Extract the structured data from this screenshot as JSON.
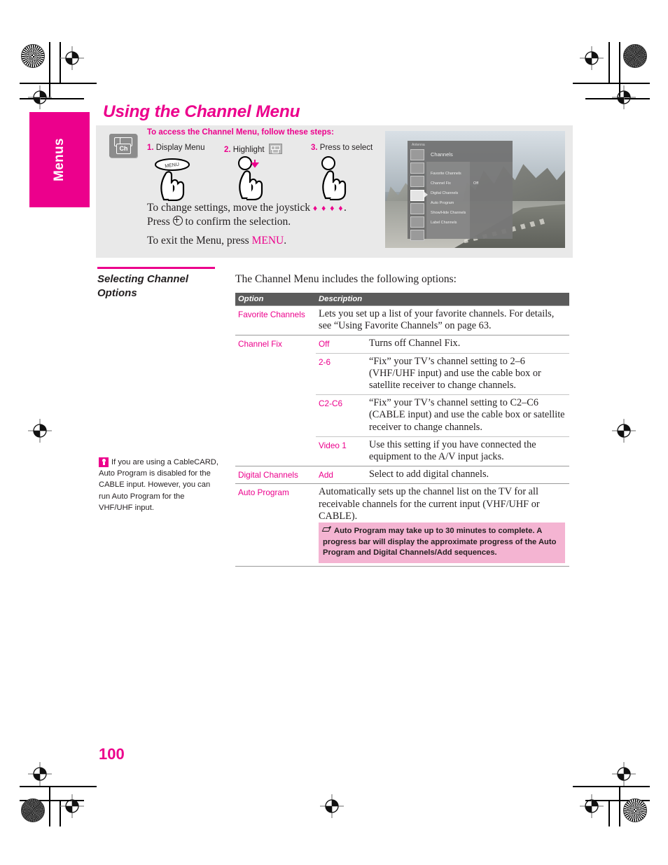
{
  "page": {
    "number": "100",
    "side_tab_label": "Menus",
    "title": "Using the Channel Menu"
  },
  "info_panel": {
    "icon_label": "Ch",
    "steps_heading": "To access the Channel Menu, follow these steps:",
    "steps": [
      {
        "num": "1.",
        "label": "Display Menu"
      },
      {
        "num": "2.",
        "label": "Highlight"
      },
      {
        "num": "3.",
        "label": "Press to select"
      }
    ],
    "remote_button_label": "MENU",
    "instruction_line1_a": "To change settings, move the joystick ",
    "instruction_line1_arrows": "♦ ♦ ♦ ♦",
    "instruction_line1_b": ".",
    "instruction_line2_a": "Press ",
    "instruction_line2_b": " to confirm the selection.",
    "instruction_exit_a": "To exit the Menu, press ",
    "instruction_exit_menu": "MENU",
    "instruction_exit_b": "."
  },
  "tv_osd": {
    "antenna_label": "Antenna",
    "title": "Channels",
    "items": [
      {
        "label": "Favorite Channels",
        "value": ""
      },
      {
        "label": "Channel Fix",
        "value": "Off"
      },
      {
        "label": "Digital Channels",
        "value": ""
      },
      {
        "label": "Auto Program",
        "value": ""
      },
      {
        "label": "Show/Hide Channels",
        "value": ""
      },
      {
        "label": "Label Channels",
        "value": ""
      }
    ]
  },
  "section": {
    "heading": "Selecting Channel Options",
    "intro": "The Channel Menu includes the following options:"
  },
  "tip": {
    "icon": "lightbulb-icon",
    "text": "If you are using a CableCARD, Auto Program is disabled for the CABLE input. However, you can run Auto Program for the VHF/UHF input."
  },
  "table": {
    "headers": {
      "option": "Option",
      "description": "Description"
    },
    "rows": [
      {
        "option": "Favorite Channels",
        "value": "",
        "description": "Lets you set up a list of your favorite channels. For details, see “Using Favorite Channels” on page 63."
      },
      {
        "option": "Channel Fix",
        "value": "Off",
        "description": "Turns off Channel Fix."
      },
      {
        "option": "",
        "value": "2-6",
        "description": "“Fix” your TV’s channel setting to 2–6 (VHF/UHF input) and use the cable box or satellite receiver to change channels."
      },
      {
        "option": "",
        "value": "C2-C6",
        "description": "“Fix” your TV’s channel setting to C2–C6 (CABLE input) and use the cable box or satellite receiver to change channels."
      },
      {
        "option": "",
        "value": "Video 1",
        "description": "Use this setting if you have connected the equipment to the A/V input jacks."
      },
      {
        "option": "Digital Channels",
        "value": "Add",
        "description": "Select to add digital channels."
      },
      {
        "option": "Auto Program",
        "value": "",
        "description": "Automatically sets up the channel list on the TV for all receivable channels for the current input (VHF/UHF or CABLE)."
      }
    ],
    "note": "Auto Program may take up to 30 minutes to complete. A progress bar will display the approximate progress of the Auto Program and Digital Channels/Add sequences."
  },
  "colors": {
    "accent": "#ec008c",
    "panel_bg": "#e9e9e9",
    "table_header_bg": "#5b5b5b",
    "note_bg": "#f4b4d2",
    "text": "#231f20"
  }
}
